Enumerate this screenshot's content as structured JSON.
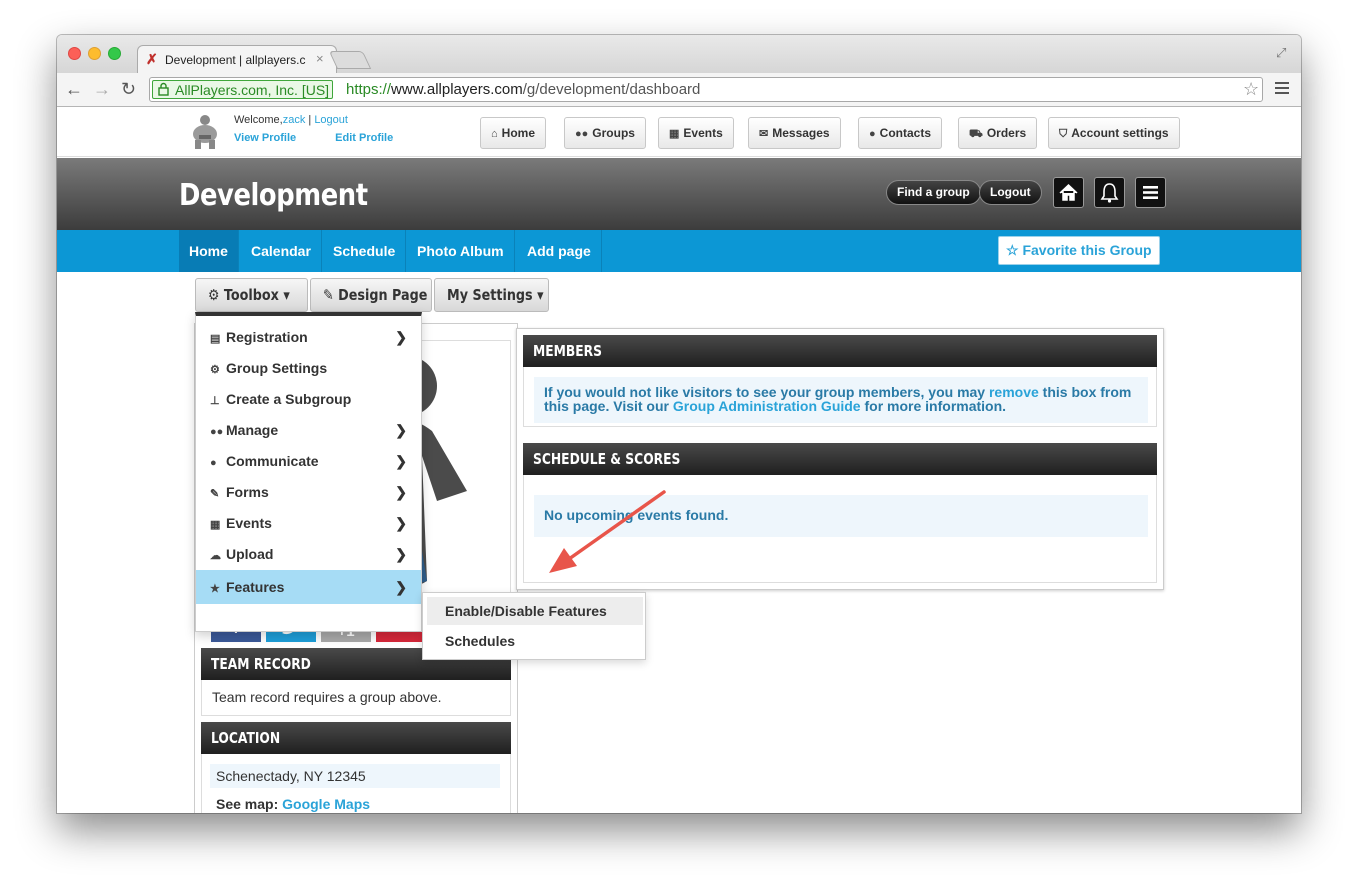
{
  "browser": {
    "tab_title": "Development | allplayers.c",
    "ev_label": "AllPlayers.com, Inc. [US]",
    "url_scheme": "https://",
    "url_host": "www.allplayers.com",
    "url_path": "/g/development/dashboard"
  },
  "topnav": {
    "welcome_prefix": "Welcome,",
    "username": "zack",
    "separator": "|",
    "logout": "Logout",
    "view_profile": "View Profile",
    "edit_profile": "Edit Profile",
    "buttons": [
      {
        "label": "Home",
        "icon": "home-icon"
      },
      {
        "label": "Groups",
        "icon": "users-icon"
      },
      {
        "label": "Events",
        "icon": "calendar-icon"
      },
      {
        "label": "Messages",
        "icon": "envelope-icon"
      },
      {
        "label": "Contacts",
        "icon": "user-icon"
      },
      {
        "label": "Orders",
        "icon": "cart-icon"
      },
      {
        "label": "Account settings",
        "icon": "shield-icon"
      }
    ]
  },
  "banner": {
    "title": "Development",
    "find_group": "Find a group",
    "logout": "Logout"
  },
  "groupnav": {
    "items": [
      "Home",
      "Calendar",
      "Schedule",
      "Photo Album",
      "Add page"
    ],
    "favorite": "Favorite this Group"
  },
  "toolbar": {
    "toolbox": "Toolbox",
    "design_page": "Design Page",
    "my_settings": "My Settings"
  },
  "toolbox_menu": {
    "items": [
      {
        "label": "Registration",
        "icon": "list-icon",
        "submenu": true
      },
      {
        "label": "Group Settings",
        "icon": "gear-icon",
        "submenu": false
      },
      {
        "label": "Create a Subgroup",
        "icon": "sitemap-icon",
        "submenu": false
      },
      {
        "label": "Manage",
        "icon": "users-icon",
        "submenu": true
      },
      {
        "label": "Communicate",
        "icon": "comments-icon",
        "submenu": true
      },
      {
        "label": "Forms",
        "icon": "edit-icon",
        "submenu": true
      },
      {
        "label": "Events",
        "icon": "calendar-icon",
        "submenu": true
      },
      {
        "label": "Upload",
        "icon": "cloud-upload-icon",
        "submenu": true
      },
      {
        "label": "Features",
        "icon": "star-icon",
        "submenu": true
      }
    ],
    "features_submenu": [
      "Enable/Disable Features",
      "Schedules"
    ]
  },
  "share": {
    "facebook": "f",
    "google_plus": "+1",
    "more": "+"
  },
  "team_record": {
    "title": "TEAM RECORD",
    "text": "Team record requires a group above."
  },
  "location": {
    "title": "LOCATION",
    "address": "Schenectady, NY 12345",
    "see_map": "See map:",
    "map_link": "Google Maps"
  },
  "members": {
    "title": "MEMBERS",
    "text_1": "If you would not like visitors to see your group members, you may ",
    "link_remove": "remove",
    "text_2": " this box from this page. Visit our ",
    "link_guide": "Group Administration Guide",
    "text_3": " for more information."
  },
  "schedule": {
    "title": "SCHEDULE & SCORES",
    "empty": "No upcoming events found."
  },
  "colors": {
    "accent_blue": "#0c97d5",
    "link": "#2aa3d8",
    "highlight": "#a6dcf5",
    "arrow": "#e8554a"
  }
}
